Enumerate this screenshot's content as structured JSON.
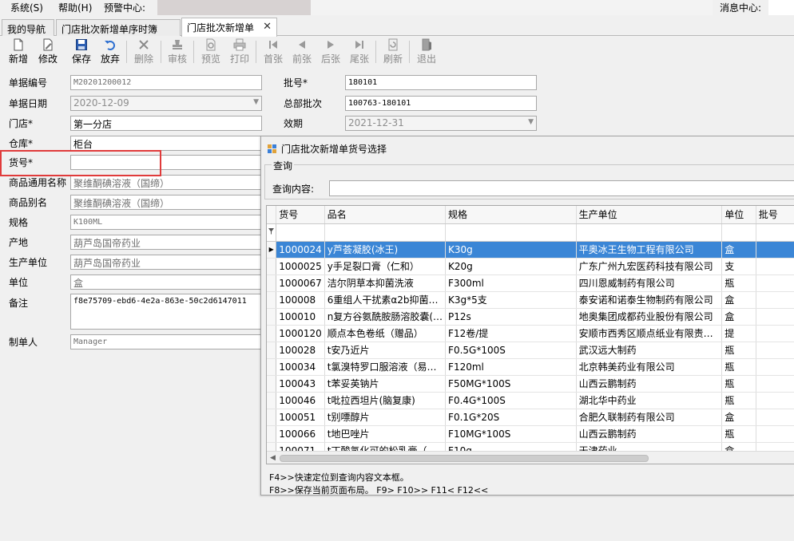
{
  "menu": {
    "items": [
      "系统(S)",
      "帮助(H)",
      "预警中心:"
    ],
    "message_center": "消息中心:"
  },
  "tabs": [
    {
      "label": "我的导航",
      "active": false
    },
    {
      "label": "门店批次新增单序时簿",
      "active": false
    },
    {
      "label": "门店批次新增单",
      "active": true
    }
  ],
  "toolbar": {
    "buttons": [
      {
        "label": "新增",
        "icon": "new-document-icon",
        "enabled": true
      },
      {
        "label": "修改",
        "icon": "edit-document-icon",
        "enabled": true
      },
      {
        "label": "保存",
        "icon": "save-disk-icon",
        "enabled": true
      },
      {
        "label": "放弃",
        "icon": "undo-arrow-icon",
        "enabled": true
      },
      {
        "label": "删除",
        "icon": "delete-x-icon",
        "enabled": false
      },
      {
        "label": "审核",
        "icon": "approve-stamp-icon",
        "enabled": false
      },
      {
        "label": "预览",
        "icon": "print-preview-icon",
        "enabled": false
      },
      {
        "label": "打印",
        "icon": "printer-icon",
        "enabled": false
      },
      {
        "label": "首张",
        "icon": "first-record-icon",
        "enabled": false
      },
      {
        "label": "前张",
        "icon": "previous-record-icon",
        "enabled": false
      },
      {
        "label": "后张",
        "icon": "next-record-icon",
        "enabled": false
      },
      {
        "label": "尾张",
        "icon": "last-record-icon",
        "enabled": false
      },
      {
        "label": "刷新",
        "icon": "refresh-icon",
        "enabled": false
      },
      {
        "label": "退出",
        "icon": "exit-door-icon",
        "enabled": false
      }
    ]
  },
  "form": {
    "doc_no": {
      "label": "单据编号",
      "value": "M20201200012"
    },
    "doc_date": {
      "label": "单据日期",
      "value": "2020-12-09"
    },
    "store": {
      "label": "门店*",
      "value": "第一分店"
    },
    "warehouse": {
      "label": "仓库*",
      "value": "柜台"
    },
    "item_no": {
      "label": "货号*",
      "value": ""
    },
    "generic_name": {
      "label": "商品通用名称",
      "value": "聚维酮碘溶液（国缔）"
    },
    "alias": {
      "label": "商品别名",
      "value": "聚维酮碘溶液（国缔）"
    },
    "spec": {
      "label": "规格",
      "value": "K100ML"
    },
    "origin": {
      "label": "产地",
      "value": "葫芦岛国帝药业"
    },
    "producer": {
      "label": "生产单位",
      "value": "葫芦岛国帝药业"
    },
    "unit": {
      "label": "单位",
      "value": "盒"
    },
    "remark": {
      "label": "备注",
      "value": "f8e75709-ebd6-4e2a-863e-50c2d6147011"
    },
    "maker": {
      "label": "制单人",
      "value": "Manager"
    },
    "batch_no": {
      "label": "批号*",
      "value": "180101"
    },
    "hq_batch": {
      "label": "总部批次",
      "value": "100763-180101"
    },
    "expiry": {
      "label": "效期",
      "value": "2021-12-31"
    }
  },
  "popup": {
    "title": "门店批次新增单货号选择",
    "group_label": "查询",
    "query_label": "查询内容:",
    "query_value": "",
    "columns": [
      "货号",
      "品名",
      "规格",
      "生产单位",
      "单位",
      "批号"
    ],
    "rows": [
      [
        "1000024",
        "y芦荟凝胶(冰王)",
        "K30g",
        "平奥冰王生物工程有限公司",
        "盒",
        ""
      ],
      [
        "1000025",
        "y手足裂口膏（仁和）",
        "K20g",
        "广东广州九宏医药科技有限公司",
        "支",
        ""
      ],
      [
        "1000067",
        "洁尔阴草本抑菌洗液",
        "F300ml",
        "四川恩威制药有限公司",
        "瓶",
        ""
      ],
      [
        "100008",
        "6重组人干扰素α2b抑菌…",
        "K3g*5支",
        "泰安诺和诺泰生物制药有限公司",
        "盒",
        ""
      ],
      [
        "100010",
        "n复方谷氨酰胺肠溶胶囊(…",
        "P12s",
        "地奥集团成都药业股份有限公司",
        "盒",
        ""
      ],
      [
        "1000120",
        "顺点本色卷纸（赠品）",
        "F12卷/提",
        "安顺市西秀区顺点纸业有限责…",
        "提",
        ""
      ],
      [
        "100028",
        "t安乃近片",
        "F0.5G*100S",
        "武汉远大制药",
        "瓶",
        ""
      ],
      [
        "100034",
        "t氯溴特罗口服溶液（易…",
        "F120ml",
        "北京韩美药业有限公司",
        "瓶",
        ""
      ],
      [
        "100043",
        "t苯妥英钠片",
        "F50MG*100S",
        "山西云鹏制药",
        "瓶",
        ""
      ],
      [
        "100046",
        "t吡拉西坦片(脑复康)",
        "F0.4G*100S",
        "湖北华中药业",
        "瓶",
        ""
      ],
      [
        "100051",
        "t别嘌醇片",
        "F0.1G*20S",
        "合肥久联制药有限公司",
        "盒",
        ""
      ],
      [
        "100066",
        "t地巴唑片",
        "F10MG*100S",
        "山西云鹏制药",
        "瓶",
        ""
      ],
      [
        "100071",
        "t丁酸氢化可的松乳膏（…",
        "F10g",
        "天津药业",
        "盒",
        ""
      ]
    ],
    "selected_row": 0,
    "hint1": "F4>>快速定位到查询内容文本框。",
    "hint2": "F8>>保存当前页面布局。 F9> F10>> F11< F12<<"
  }
}
